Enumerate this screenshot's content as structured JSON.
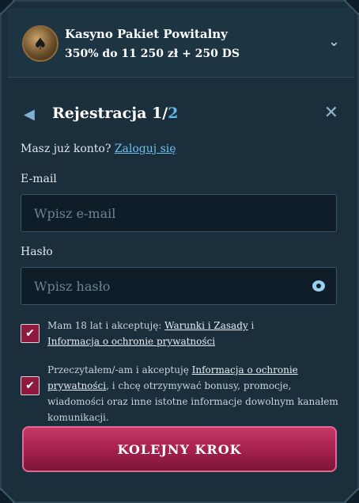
{
  "bonus": {
    "title": "Kasyno Pakiet Powitalny",
    "subtitle": "350% do 11 250 zł + 250 DS",
    "icon": "casino-chip-icon"
  },
  "registration": {
    "title_prefix": "Rejestracja 1/",
    "title_step": "2"
  },
  "login_prompt": {
    "text": "Masz już konto?",
    "link": "Zaloguj się"
  },
  "email": {
    "label": "E-mail",
    "placeholder": "Wpisz e-mail",
    "value": ""
  },
  "password": {
    "label": "Hasło",
    "placeholder": "Wpisz hasło",
    "value": ""
  },
  "consent_age": {
    "checked": true,
    "text_before": "Mam 18 lat i akceptuję: ",
    "terms_link": "Warunki i Zasady",
    "text_between": " i",
    "privacy_link": "Informacja o ochronie prywatności"
  },
  "consent_marketing": {
    "checked": true,
    "text_before": "Przeczytałem/-am i akceptuję ",
    "privacy_link": "Informacja o ochronie prywatności",
    "text_after": ", i chcę otrzymywać bonusy, promocje, wiadomości oraz inne istotne informacje dowolnym kanałem komunikacji."
  },
  "next_button": {
    "label": "KOLEJNY KROK"
  },
  "colors": {
    "panel": "#1a2e3b",
    "accent_link": "#6ec1ec",
    "button": "#a3204c",
    "checkbox": "#8e1b3d"
  }
}
